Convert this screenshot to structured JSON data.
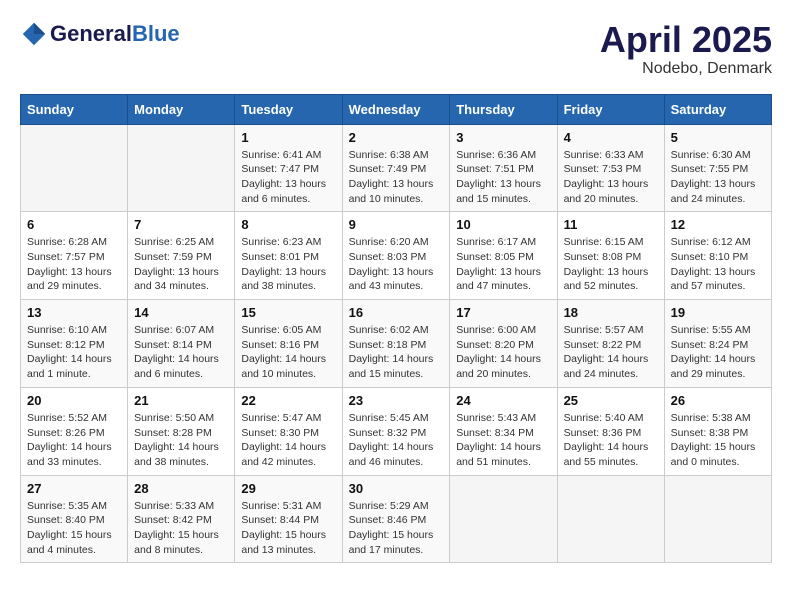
{
  "header": {
    "logo_general": "General",
    "logo_blue": "Blue",
    "month": "April 2025",
    "location": "Nodebo, Denmark"
  },
  "weekdays": [
    "Sunday",
    "Monday",
    "Tuesday",
    "Wednesday",
    "Thursday",
    "Friday",
    "Saturday"
  ],
  "weeks": [
    [
      {
        "day": "",
        "info": ""
      },
      {
        "day": "",
        "info": ""
      },
      {
        "day": "1",
        "info": "Sunrise: 6:41 AM\nSunset: 7:47 PM\nDaylight: 13 hours and 6 minutes."
      },
      {
        "day": "2",
        "info": "Sunrise: 6:38 AM\nSunset: 7:49 PM\nDaylight: 13 hours and 10 minutes."
      },
      {
        "day": "3",
        "info": "Sunrise: 6:36 AM\nSunset: 7:51 PM\nDaylight: 13 hours and 15 minutes."
      },
      {
        "day": "4",
        "info": "Sunrise: 6:33 AM\nSunset: 7:53 PM\nDaylight: 13 hours and 20 minutes."
      },
      {
        "day": "5",
        "info": "Sunrise: 6:30 AM\nSunset: 7:55 PM\nDaylight: 13 hours and 24 minutes."
      }
    ],
    [
      {
        "day": "6",
        "info": "Sunrise: 6:28 AM\nSunset: 7:57 PM\nDaylight: 13 hours and 29 minutes."
      },
      {
        "day": "7",
        "info": "Sunrise: 6:25 AM\nSunset: 7:59 PM\nDaylight: 13 hours and 34 minutes."
      },
      {
        "day": "8",
        "info": "Sunrise: 6:23 AM\nSunset: 8:01 PM\nDaylight: 13 hours and 38 minutes."
      },
      {
        "day": "9",
        "info": "Sunrise: 6:20 AM\nSunset: 8:03 PM\nDaylight: 13 hours and 43 minutes."
      },
      {
        "day": "10",
        "info": "Sunrise: 6:17 AM\nSunset: 8:05 PM\nDaylight: 13 hours and 47 minutes."
      },
      {
        "day": "11",
        "info": "Sunrise: 6:15 AM\nSunset: 8:08 PM\nDaylight: 13 hours and 52 minutes."
      },
      {
        "day": "12",
        "info": "Sunrise: 6:12 AM\nSunset: 8:10 PM\nDaylight: 13 hours and 57 minutes."
      }
    ],
    [
      {
        "day": "13",
        "info": "Sunrise: 6:10 AM\nSunset: 8:12 PM\nDaylight: 14 hours and 1 minute."
      },
      {
        "day": "14",
        "info": "Sunrise: 6:07 AM\nSunset: 8:14 PM\nDaylight: 14 hours and 6 minutes."
      },
      {
        "day": "15",
        "info": "Sunrise: 6:05 AM\nSunset: 8:16 PM\nDaylight: 14 hours and 10 minutes."
      },
      {
        "day": "16",
        "info": "Sunrise: 6:02 AM\nSunset: 8:18 PM\nDaylight: 14 hours and 15 minutes."
      },
      {
        "day": "17",
        "info": "Sunrise: 6:00 AM\nSunset: 8:20 PM\nDaylight: 14 hours and 20 minutes."
      },
      {
        "day": "18",
        "info": "Sunrise: 5:57 AM\nSunset: 8:22 PM\nDaylight: 14 hours and 24 minutes."
      },
      {
        "day": "19",
        "info": "Sunrise: 5:55 AM\nSunset: 8:24 PM\nDaylight: 14 hours and 29 minutes."
      }
    ],
    [
      {
        "day": "20",
        "info": "Sunrise: 5:52 AM\nSunset: 8:26 PM\nDaylight: 14 hours and 33 minutes."
      },
      {
        "day": "21",
        "info": "Sunrise: 5:50 AM\nSunset: 8:28 PM\nDaylight: 14 hours and 38 minutes."
      },
      {
        "day": "22",
        "info": "Sunrise: 5:47 AM\nSunset: 8:30 PM\nDaylight: 14 hours and 42 minutes."
      },
      {
        "day": "23",
        "info": "Sunrise: 5:45 AM\nSunset: 8:32 PM\nDaylight: 14 hours and 46 minutes."
      },
      {
        "day": "24",
        "info": "Sunrise: 5:43 AM\nSunset: 8:34 PM\nDaylight: 14 hours and 51 minutes."
      },
      {
        "day": "25",
        "info": "Sunrise: 5:40 AM\nSunset: 8:36 PM\nDaylight: 14 hours and 55 minutes."
      },
      {
        "day": "26",
        "info": "Sunrise: 5:38 AM\nSunset: 8:38 PM\nDaylight: 15 hours and 0 minutes."
      }
    ],
    [
      {
        "day": "27",
        "info": "Sunrise: 5:35 AM\nSunset: 8:40 PM\nDaylight: 15 hours and 4 minutes."
      },
      {
        "day": "28",
        "info": "Sunrise: 5:33 AM\nSunset: 8:42 PM\nDaylight: 15 hours and 8 minutes."
      },
      {
        "day": "29",
        "info": "Sunrise: 5:31 AM\nSunset: 8:44 PM\nDaylight: 15 hours and 13 minutes."
      },
      {
        "day": "30",
        "info": "Sunrise: 5:29 AM\nSunset: 8:46 PM\nDaylight: 15 hours and 17 minutes."
      },
      {
        "day": "",
        "info": ""
      },
      {
        "day": "",
        "info": ""
      },
      {
        "day": "",
        "info": ""
      }
    ]
  ]
}
